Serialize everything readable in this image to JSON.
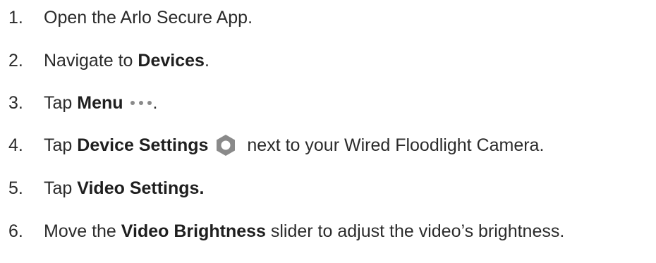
{
  "steps": [
    {
      "number": "1.",
      "text": "Open the Arlo Secure App."
    },
    {
      "number": "2.",
      "pre": "Navigate to ",
      "bold": "Devices",
      "post": "."
    },
    {
      "number": "3.",
      "pre": "Tap ",
      "bold": "Menu",
      "icon": "menu-dots-icon",
      "post": "."
    },
    {
      "number": "4.",
      "pre": "Tap ",
      "bold": "Device Settings",
      "icon": "gear-icon",
      "post": " next to your Wired Floodlight Camera."
    },
    {
      "number": "5.",
      "pre": "Tap ",
      "bold": "Video Settings."
    },
    {
      "number": "6.",
      "pre": "Move the ",
      "bold": "Video Brightness",
      "post": " slider to adjust the video’s brightness."
    }
  ],
  "colors": {
    "text": "#2b2b2b",
    "icon": "#8a8a8a"
  }
}
